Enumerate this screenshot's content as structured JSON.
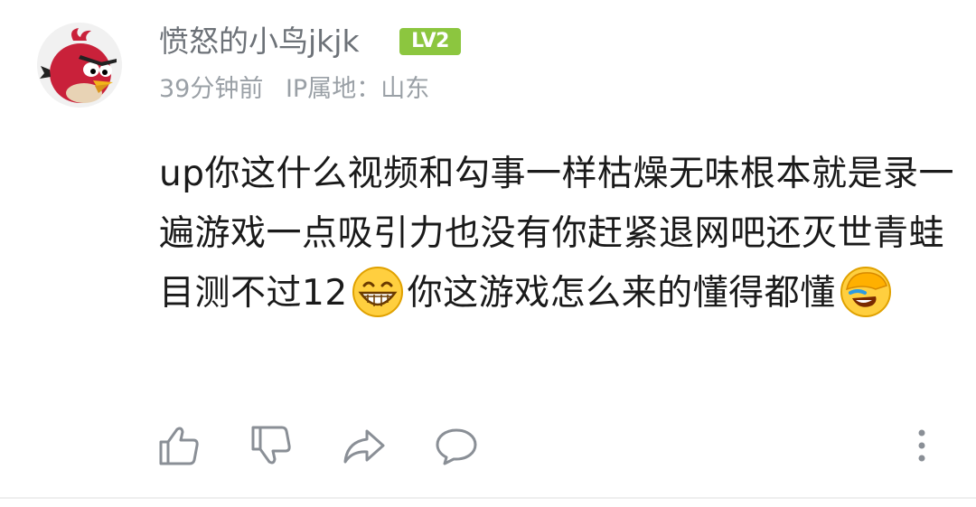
{
  "comment": {
    "username": "愤怒的小鸟jkjk",
    "level": "LV2",
    "time": "39分钟前",
    "ip_location": "IP属地：山东",
    "text_part1": "up你这什么视频和勾事一样枯燥无味根本就是录一遍游戏一点吸引力也没有你赶紧退网吧还灭世青蛙目测不过12",
    "text_part2": "你这游戏怎么来的懂得都懂",
    "emoji1": "grin-emoji",
    "emoji2": "facepalm-laugh-emoji"
  },
  "actions": {
    "like": "thumbs-up-icon",
    "dislike": "thumbs-down-icon",
    "share": "share-icon",
    "reply": "comment-icon",
    "more": "more-vertical-icon"
  },
  "colors": {
    "level_badge": "#8cc63f",
    "username": "#6d7278",
    "meta": "#9aa0a6",
    "text": "#1a1a1a"
  }
}
